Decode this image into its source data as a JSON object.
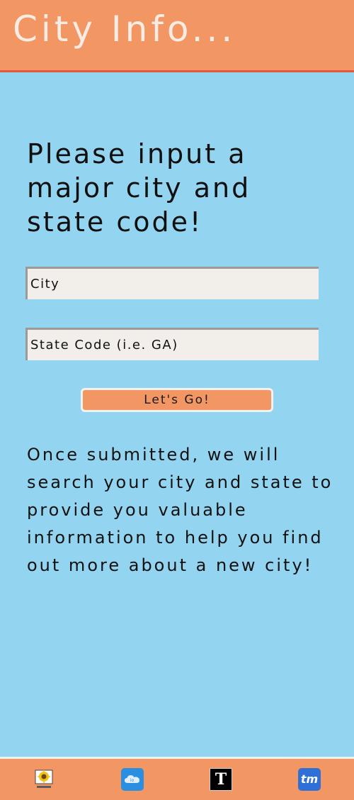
{
  "header": {
    "title": "City Info..."
  },
  "main": {
    "headline": "Please input a major city and state code!",
    "city_placeholder": "City",
    "state_placeholder": "State Code (i.e. GA)",
    "submit_label": "Let's Go!",
    "info_text": "Once submitted, we will search your city and state to provide you valuable information to help you find out more about a new city!"
  },
  "footer": {
    "icons": [
      {
        "name": "mediawiki-icon",
        "label": "MediaWiki"
      },
      {
        "name": "io-cloud-icon",
        "label": "io"
      },
      {
        "name": "nyt-icon",
        "label": "T"
      },
      {
        "name": "ticketmaster-icon",
        "label": "tm"
      }
    ]
  },
  "colors": {
    "background": "#93d5f0",
    "header": "#f29764",
    "header_border": "#e8563a",
    "field": "#f2efea"
  }
}
